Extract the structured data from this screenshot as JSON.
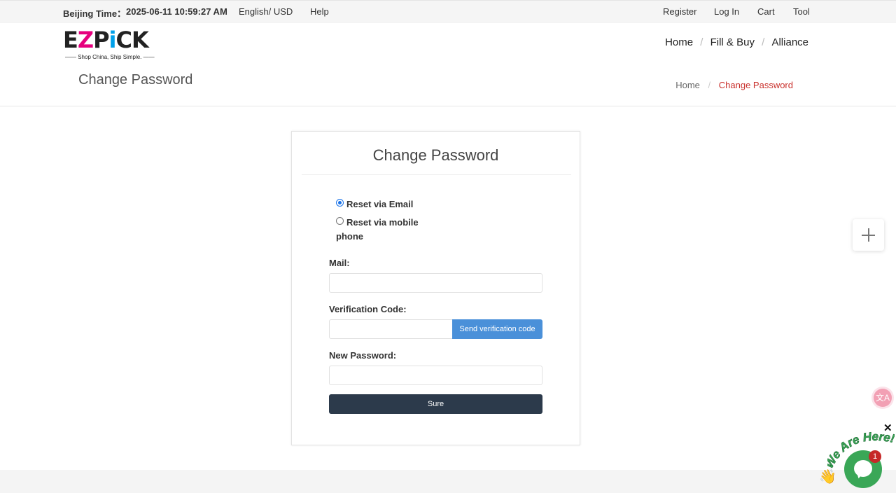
{
  "topbar": {
    "beijing_label": "Beijing Time：",
    "beijing_time": "2025-06-11 10:59:27 AM",
    "language": "English/ USD",
    "help": "Help",
    "register": "Register",
    "login": "Log In",
    "cart": "Cart",
    "tool": "Tool"
  },
  "brand": {
    "logo_e": "E",
    "logo_z": "Z",
    "logo_p": "P",
    "logo_i": "i",
    "logo_ck": "CK",
    "tagline": "—— Shop China, Ship Simple. ——"
  },
  "nav": {
    "home": "Home",
    "fill_buy": "Fill & Buy",
    "alliance": "Alliance",
    "separator": "/"
  },
  "page": {
    "title": "Change Password",
    "breadcrumb_home": "Home",
    "breadcrumb_sep": "/",
    "breadcrumb_current": "Change Password"
  },
  "form": {
    "title": "Change Password",
    "reset_email_label": "Reset via Email",
    "reset_mobile_label_line1": "Reset via mobile",
    "reset_mobile_label_line2": "phone",
    "selected_method": "email",
    "mail_label": "Mail:",
    "mail_value": "",
    "verification_label": "Verification Code:",
    "verification_value": "",
    "send_code_button": "Send verification code",
    "new_password_label": "New Password:",
    "new_password_value": "",
    "submit_button": "Sure"
  },
  "widgets": {
    "plus_icon": "plus-icon",
    "translate_glyph": "文A",
    "close_glyph": "✕",
    "chat_banner": "We Are Here!",
    "chat_badge_count": "1",
    "wave_glyph": "👋"
  },
  "colors": {
    "accent_red": "#c9302c",
    "send_button": "#4a90d9",
    "submit_button": "#2c3a4b",
    "chat_green": "#3aa757",
    "radio_blue": "#1a73e8"
  }
}
